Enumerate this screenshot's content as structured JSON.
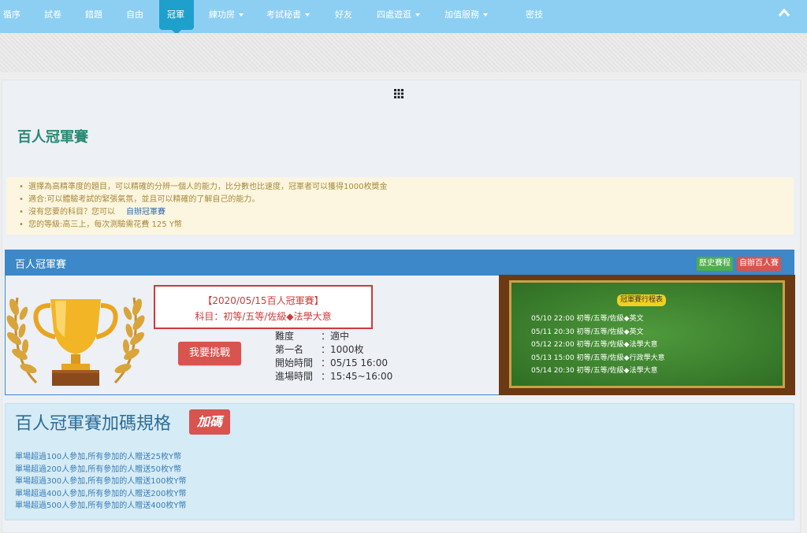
{
  "nav": {
    "items": [
      {
        "label": "循序",
        "has_caret": false
      },
      {
        "label": "試卷",
        "has_caret": false
      },
      {
        "label": "錯題",
        "has_caret": false
      },
      {
        "label": "自由",
        "has_caret": false
      },
      {
        "label": "冠軍",
        "has_caret": false,
        "active": true
      },
      {
        "label": "練功房",
        "has_caret": true
      },
      {
        "label": "考試秘書",
        "has_caret": true
      },
      {
        "label": "好友",
        "has_caret": false
      },
      {
        "label": "四處遊逛",
        "has_caret": true
      },
      {
        "label": "加值服務",
        "has_caret": true
      },
      {
        "label": "密技",
        "has_caret": false
      }
    ],
    "collapse_icon": "chevron-up-icon"
  },
  "page": {
    "menu_icon": "grid-icon",
    "title": "百人冠軍賽"
  },
  "info": {
    "line1": "選擇為高精準度的題目，可以精確的分辨一個人的能力，比分數也比速度，冠軍者可以獲得1000枚獎金",
    "line2": "適合:可以體驗考試的緊張氣氛，並且可以精確的了解自己的能力。",
    "line3_text": "沒有您要的科目？您可以",
    "line3_link": "自辦冠軍賽",
    "line4": "您的等級:高三上，每次測驗需花費 125 Y幣"
  },
  "competition": {
    "header_title": "百人冠軍賽",
    "history_button": "歷史賽程",
    "self_host_button": "自辦百人賽",
    "event_title": "【2020/05/15百人冠軍賽】",
    "event_subject": "科目：初等/五等/佐級◆法學大意",
    "challenge_button": "我要挑戰",
    "stats": [
      {
        "key": "難度",
        "value": "：適中"
      },
      {
        "key": "第一名",
        "value": "：1000枚"
      },
      {
        "key": "開始時間",
        "value": "：05/15 16:00"
      },
      {
        "key": "進場時間",
        "value": "：15:45~16:00"
      }
    ]
  },
  "schedule": {
    "title": "冠軍賽行程表",
    "entries": [
      "05/10 22:00 初等/五等/佐級◆英文",
      "05/11 20:30 初等/五等/佐級◆英文",
      "05/12 22:00 初等/五等/佐級◆法學大意",
      "05/13 15:00 初等/五等/佐級◆行政學大意",
      "05/14 20:30 初等/五等/佐級◆法學大意"
    ]
  },
  "bonus": {
    "title": "百人冠軍賽加碼規格",
    "badge": "加碼",
    "rules": [
      "單場超過100人參加,所有參加的人贈送25枚Y幣",
      "單場超過200人參加,所有參加的人贈送50枚Y幣",
      "單場超過300人參加,所有參加的人贈送100枚Y幣",
      "單場超過400人參加,所有參加的人贈送200枚Y幣",
      "單場超過500人參加,所有參加的人贈送400枚Y幣"
    ]
  }
}
